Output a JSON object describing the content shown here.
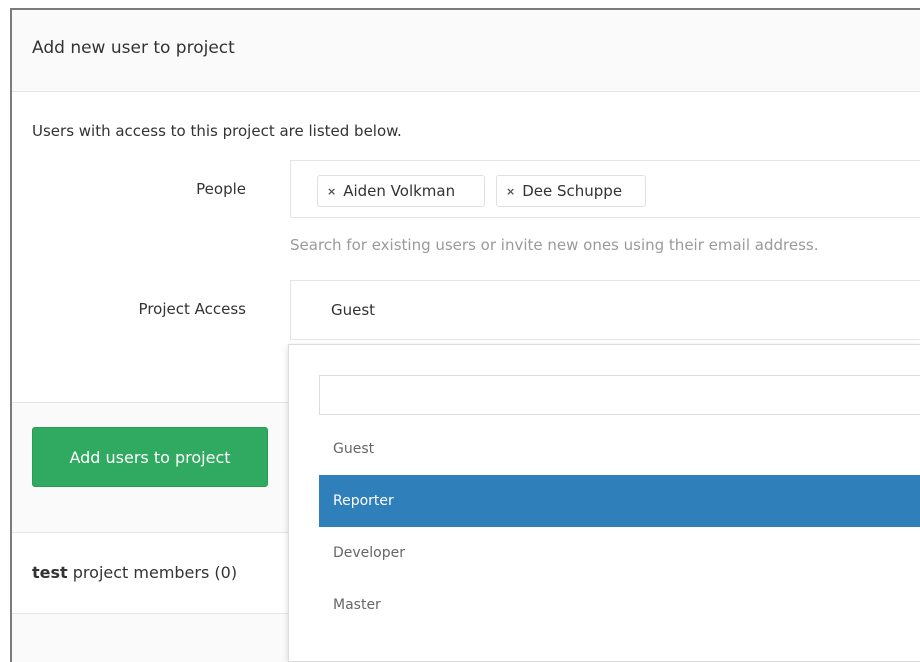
{
  "panel": {
    "title": "Add new user to project",
    "intro": "Users with access to this project are listed below."
  },
  "form": {
    "people_label": "People",
    "people_chips": [
      {
        "remove_glyph": "×",
        "name": "Aiden Volkman"
      },
      {
        "remove_glyph": "×",
        "name": "Dee Schuppe"
      }
    ],
    "people_help": "Search for existing users or invite new ones using their email address.",
    "access_label": "Project Access",
    "access_value": "Guest",
    "submit_label": "Add users to project"
  },
  "dropdown": {
    "search_value": "",
    "options": [
      "Guest",
      "Reporter",
      "Developer",
      "Master"
    ],
    "highlighted": "Reporter"
  },
  "members": {
    "project_name": "test",
    "label": "project members",
    "count": "(0)"
  },
  "colors": {
    "primary_button": "#2faa60",
    "highlight": "#2f7fbb"
  }
}
